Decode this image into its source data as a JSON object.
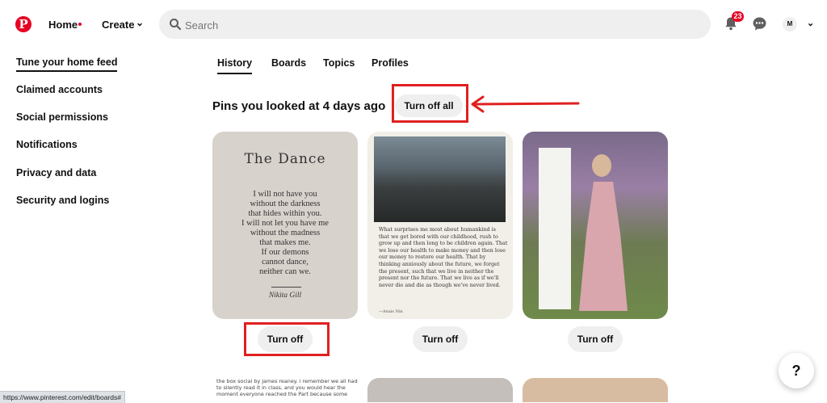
{
  "header": {
    "logo": "P",
    "nav": {
      "home": "Home",
      "create": "Create"
    },
    "search_placeholder": "Search",
    "notification_count": "23",
    "avatar_initial": "M"
  },
  "sidebar": {
    "items": [
      {
        "label": "Tune your home feed",
        "active": true
      },
      {
        "label": "Claimed accounts"
      },
      {
        "label": "Social permissions"
      },
      {
        "label": "Notifications"
      },
      {
        "label": "Privacy and data"
      },
      {
        "label": "Security and logins"
      }
    ]
  },
  "tabs": [
    {
      "label": "History",
      "active": true
    },
    {
      "label": "Boards"
    },
    {
      "label": "Topics"
    },
    {
      "label": "Profiles"
    }
  ],
  "section": {
    "title": "Pins you looked at 4 days ago",
    "turn_off_all": "Turn off all"
  },
  "pins": [
    {
      "title": "The Dance",
      "poem": "I will not have you\nwithout the darkness\nthat hides within you.\nI will not let you have me\nwithout the madness\nthat makes me.\nIf our demons\ncannot dance,\nneither can we.",
      "author": "Nikita Gill",
      "button": "Turn off"
    },
    {
      "quote": "What surprises me most about humankind is that we get bored with our childhood, rush to grow up and then long to be children again. That we lose our health to make money and then lose our money to restore our health. That by thinking anxiously about the future, we forget the present, such that we live in neither the present nor the future. That we live as if we'll never die and die as though we've never lived.",
      "quote_author": "—Anais Nin",
      "button": "Turn off"
    },
    {
      "button": "Turn off"
    }
  ],
  "partial_pin_text": "the box social by james reaney. i remember we all had to silently read it in class, and you would hear the moment everyone reached the Part because some",
  "status_url": "https://www.pinterest.com/edit/boards#",
  "help_label": "?",
  "colors": {
    "brand": "#e60023",
    "highlight": "#e02020"
  }
}
